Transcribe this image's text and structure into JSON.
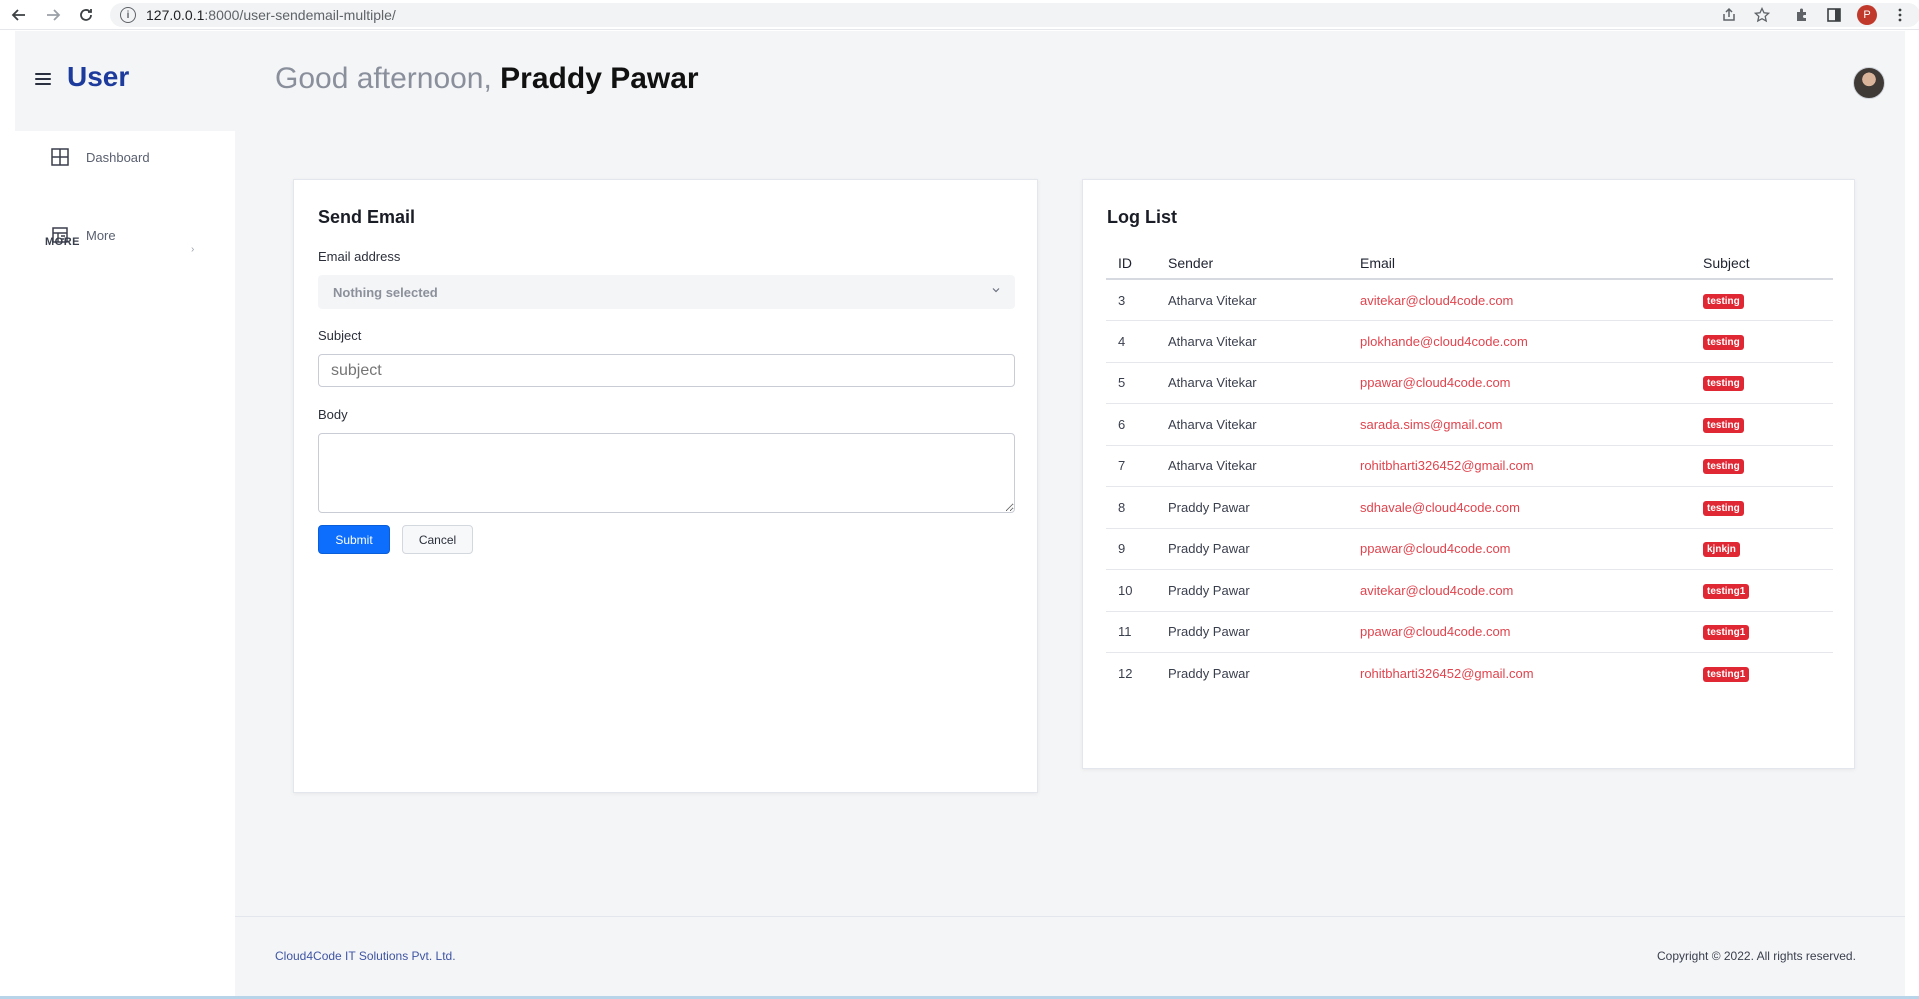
{
  "browser": {
    "url_host": "127.0.0.1",
    "url_rest": ":8000/user-sendemail-multiple/",
    "profile_initial": "P"
  },
  "header": {
    "brand": "User",
    "greeting": "Good afternoon, ",
    "user_name": "Praddy Pawar"
  },
  "sidebar": {
    "dashboard_label": "Dashboard",
    "section_label": "MORE",
    "more_label": "More"
  },
  "send_email": {
    "title": "Send Email",
    "email_label": "Email address",
    "email_selected": "Nothing selected",
    "subject_label": "Subject",
    "subject_placeholder": "subject",
    "body_label": "Body",
    "submit_label": "Submit",
    "cancel_label": "Cancel"
  },
  "log_list": {
    "title": "Log List",
    "columns": [
      "ID",
      "Sender",
      "Email",
      "Subject"
    ],
    "rows": [
      {
        "id": "3",
        "sender": "Atharva Vitekar",
        "email": "avitekar@cloud4code.com",
        "subject": "testing"
      },
      {
        "id": "4",
        "sender": "Atharva Vitekar",
        "email": "plokhande@cloud4code.com",
        "subject": "testing"
      },
      {
        "id": "5",
        "sender": "Atharva Vitekar",
        "email": "ppawar@cloud4code.com",
        "subject": "testing"
      },
      {
        "id": "6",
        "sender": "Atharva Vitekar",
        "email": "sarada.sims@gmail.com",
        "subject": "testing"
      },
      {
        "id": "7",
        "sender": "Atharva Vitekar",
        "email": "rohitbharti326452@gmail.com",
        "subject": "testing"
      },
      {
        "id": "8",
        "sender": "Praddy Pawar",
        "email": "sdhavale@cloud4code.com",
        "subject": "testing"
      },
      {
        "id": "9",
        "sender": "Praddy Pawar",
        "email": "ppawar@cloud4code.com",
        "subject": "kjnkjn"
      },
      {
        "id": "10",
        "sender": "Praddy Pawar",
        "email": "avitekar@cloud4code.com",
        "subject": "testing1"
      },
      {
        "id": "11",
        "sender": "Praddy Pawar",
        "email": "ppawar@cloud4code.com",
        "subject": "testing1"
      },
      {
        "id": "12",
        "sender": "Praddy Pawar",
        "email": "rohitbharti326452@gmail.com",
        "subject": "testing1"
      }
    ]
  },
  "footer": {
    "company": "Cloud4Code IT Solutions Pvt. Ltd.",
    "copyright": "Copyright © 2022. All rights reserved."
  },
  "colors": {
    "brand": "#1d3b9c",
    "primary_button": "#0d6efd",
    "badge": "#e02834",
    "email_link": "#e0444e"
  },
  "icons": [
    "back-arrow-icon",
    "forward-arrow-icon",
    "reload-icon",
    "info-icon",
    "share-icon",
    "star-icon",
    "extensions-icon",
    "sidepanel-icon",
    "kebab-menu-icon",
    "hamburger-icon",
    "dashboard-grid-icon",
    "layout-icon",
    "chevron-right-icon",
    "chevron-down-icon"
  ]
}
